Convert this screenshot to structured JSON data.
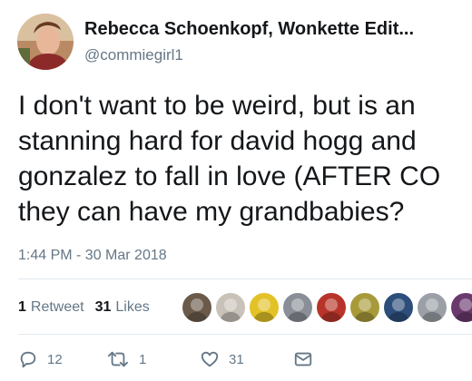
{
  "tweet": {
    "display_name": "Rebecca Schoenkopf, Wonkette Edit...",
    "handle": "@commiegirl1",
    "text_lines": [
      "I don't want to be weird, but is an",
      "stanning hard for david hogg and",
      "gonzalez to fall in love (AFTER CO",
      "they can have my grandbabies?"
    ],
    "timestamp": "1:44 PM - 30 Mar 2018"
  },
  "stats": {
    "retweets_count": "1",
    "retweets_label": "Retweet",
    "likes_count": "31",
    "likes_label": "Likes"
  },
  "likers": [
    {
      "icon": "user-avatar-1",
      "color": "#6b5a4a"
    },
    {
      "icon": "user-avatar-2",
      "color": "#c9c2b8"
    },
    {
      "icon": "user-avatar-3",
      "color": "#e2c227"
    },
    {
      "icon": "user-avatar-4",
      "color": "#8a8f97"
    },
    {
      "icon": "user-avatar-5",
      "color": "#b8342a"
    },
    {
      "icon": "user-avatar-6",
      "color": "#a89a3a"
    },
    {
      "icon": "user-avatar-7",
      "color": "#2d4e7a"
    },
    {
      "icon": "user-avatar-8",
      "color": "#9aa0a6"
    },
    {
      "icon": "user-avatar-9",
      "color": "#6a3a6e"
    }
  ],
  "actions": {
    "reply_count": "12",
    "retweet_count": "1",
    "like_count": "31"
  },
  "colors": {
    "text": "#14171a",
    "secondary": "#657786",
    "divider": "#e1e8ed"
  }
}
